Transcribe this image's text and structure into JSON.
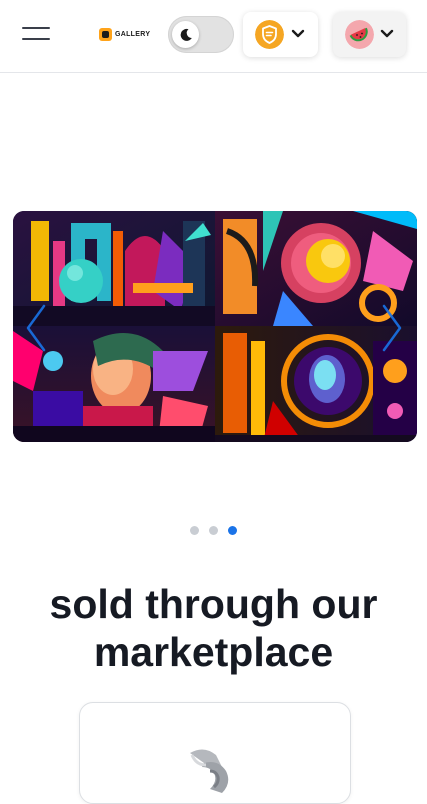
{
  "header": {
    "logo_text": "GALLERY",
    "menu_icon": "hamburger-menu-icon",
    "theme_toggle_icon": "moon-icon",
    "wallet_icon": "shield-wallet-icon",
    "account_icon": "watermelon-avatar-icon",
    "chevron_icon": "chevron-down-icon",
    "colors": {
      "wallet_accent": "#f5a623",
      "account_accent": "#f45b69"
    }
  },
  "carousel": {
    "slide_image": "abstract-colorful-collage",
    "prev_icon": "chevron-left-icon",
    "next_icon": "chevron-right-icon",
    "total_slides": 3,
    "active_slide": 3,
    "colors": {
      "dot_active": "#1a73e8",
      "dot_inactive": "#c9cdd3"
    }
  },
  "section": {
    "headline": "sold through our marketplace"
  },
  "card": {
    "icon": "ring-illustration-icon"
  }
}
